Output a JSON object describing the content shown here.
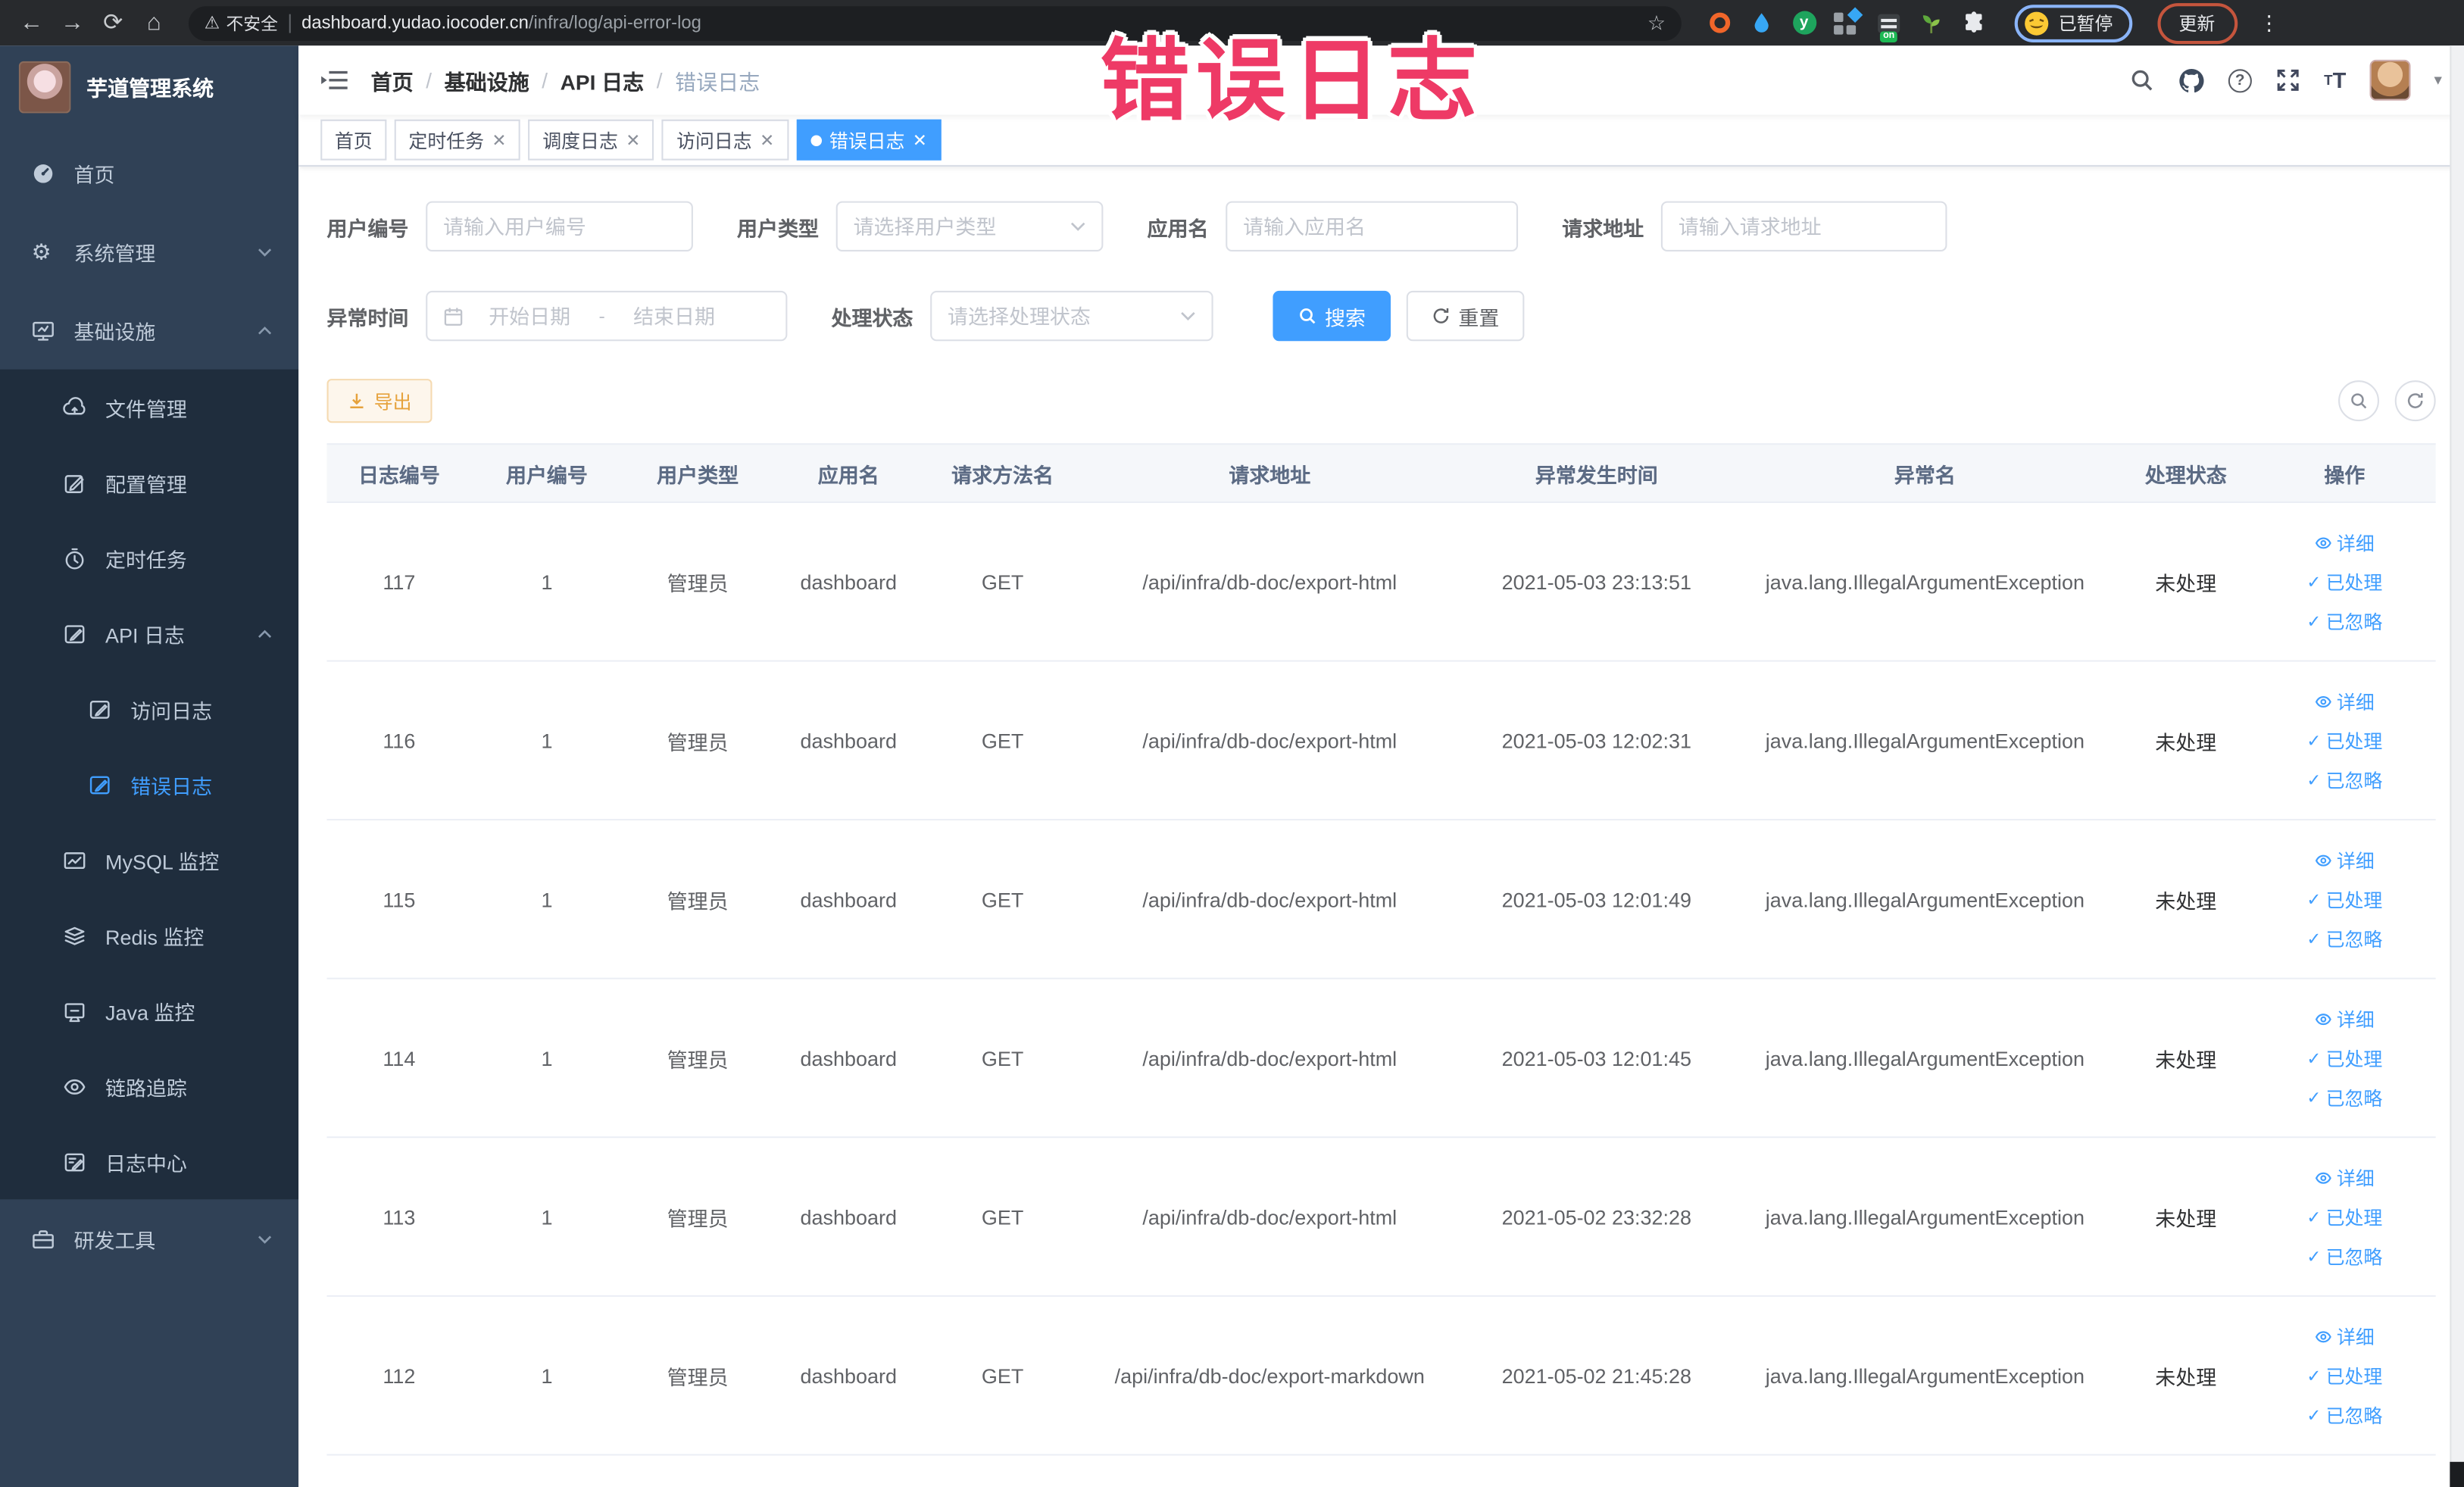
{
  "theme": {
    "primary": "#409eff",
    "warning": "#e6a23c",
    "sidebar_bg": "#304156",
    "submenu_bg": "#1f2d3d",
    "annotation_color": "#ee3a66",
    "active_tab_bg": "#409eff"
  },
  "browser": {
    "security_label": "不安全",
    "url_host": "dashboard.yudao.iocoder.cn",
    "url_path": "/infra/log/api-error-log",
    "paused_label": "已暂停",
    "update_label": "更新"
  },
  "annotation": {
    "text": "错误日志"
  },
  "sidebar": {
    "title": "芋道管理系统",
    "items": [
      {
        "label": "首页",
        "icon": "dashboard-icon"
      },
      {
        "label": "系统管理",
        "icon": "gear-icon",
        "chevron": "down"
      },
      {
        "label": "基础设施",
        "icon": "infra-icon",
        "chevron": "up"
      },
      {
        "label": "文件管理",
        "icon": "cloud-upload-icon"
      },
      {
        "label": "配置管理",
        "icon": "edit-icon"
      },
      {
        "label": "定时任务",
        "icon": "timer-icon"
      },
      {
        "label": "API 日志",
        "icon": "api-log-icon",
        "chevron": "up"
      },
      {
        "label": "访问日志",
        "icon": "access-log-icon"
      },
      {
        "label": "错误日志",
        "icon": "error-log-icon",
        "active": true
      },
      {
        "label": "MySQL 监控",
        "icon": "mysql-monitor-icon"
      },
      {
        "label": "Redis 监控",
        "icon": "redis-icon"
      },
      {
        "label": "Java 监控",
        "icon": "java-monitor-icon"
      },
      {
        "label": "链路追踪",
        "icon": "trace-eye-icon"
      },
      {
        "label": "日志中心",
        "icon": "log-center-icon"
      },
      {
        "label": "研发工具",
        "icon": "toolbox-icon",
        "chevron": "down"
      }
    ]
  },
  "breadcrumb": {
    "items": [
      "首页",
      "基础设施",
      "API 日志",
      "错误日志"
    ]
  },
  "tabs": [
    {
      "label": "首页",
      "closable": false,
      "active": false
    },
    {
      "label": "定时任务",
      "closable": true,
      "active": false
    },
    {
      "label": "调度日志",
      "closable": true,
      "active": false
    },
    {
      "label": "访问日志",
      "closable": true,
      "active": false
    },
    {
      "label": "错误日志",
      "closable": true,
      "active": true
    }
  ],
  "filters": {
    "user_id": {
      "label": "用户编号",
      "placeholder": "请输入用户编号",
      "value": ""
    },
    "user_type": {
      "label": "用户类型",
      "placeholder": "请选择用户类型",
      "value": ""
    },
    "app_name": {
      "label": "应用名",
      "placeholder": "请输入应用名",
      "value": ""
    },
    "request_url": {
      "label": "请求地址",
      "placeholder": "请输入请求地址",
      "value": ""
    },
    "exception_time": {
      "label": "异常时间",
      "start_placeholder": "开始日期",
      "separator": "-",
      "end_placeholder": "结束日期",
      "value": ""
    },
    "process_status": {
      "label": "处理状态",
      "placeholder": "请选择处理状态",
      "value": ""
    },
    "search_label": "搜索",
    "reset_label": "重置"
  },
  "toolbar": {
    "export_label": "导出"
  },
  "table": {
    "columns": [
      "日志编号",
      "用户编号",
      "用户类型",
      "应用名",
      "请求方法名",
      "请求地址",
      "异常发生时间",
      "异常名",
      "处理状态",
      "操作"
    ],
    "action_labels": {
      "detail": "详细",
      "processed": "已处理",
      "ignored": "已忽略"
    },
    "rows": [
      {
        "id": "117",
        "user_id": "1",
        "user_type": "管理员",
        "app": "dashboard",
        "method": "GET",
        "url": "/api/infra/db-doc/export-html",
        "time": "2021-05-03 23:13:51",
        "exception": "java.lang.IllegalArgumentException",
        "status": "未处理"
      },
      {
        "id": "116",
        "user_id": "1",
        "user_type": "管理员",
        "app": "dashboard",
        "method": "GET",
        "url": "/api/infra/db-doc/export-html",
        "time": "2021-05-03 12:02:31",
        "exception": "java.lang.IllegalArgumentException",
        "status": "未处理"
      },
      {
        "id": "115",
        "user_id": "1",
        "user_type": "管理员",
        "app": "dashboard",
        "method": "GET",
        "url": "/api/infra/db-doc/export-html",
        "time": "2021-05-03 12:01:49",
        "exception": "java.lang.IllegalArgumentException",
        "status": "未处理"
      },
      {
        "id": "114",
        "user_id": "1",
        "user_type": "管理员",
        "app": "dashboard",
        "method": "GET",
        "url": "/api/infra/db-doc/export-html",
        "time": "2021-05-03 12:01:45",
        "exception": "java.lang.IllegalArgumentException",
        "status": "未处理"
      },
      {
        "id": "113",
        "user_id": "1",
        "user_type": "管理员",
        "app": "dashboard",
        "method": "GET",
        "url": "/api/infra/db-doc/export-html",
        "time": "2021-05-02 23:32:28",
        "exception": "java.lang.IllegalArgumentException",
        "status": "未处理"
      },
      {
        "id": "112",
        "user_id": "1",
        "user_type": "管理员",
        "app": "dashboard",
        "method": "GET",
        "url": "/api/infra/db-doc/export-markdown",
        "time": "2021-05-02 21:45:28",
        "exception": "java.lang.IllegalArgumentException",
        "status": "未处理"
      }
    ]
  }
}
